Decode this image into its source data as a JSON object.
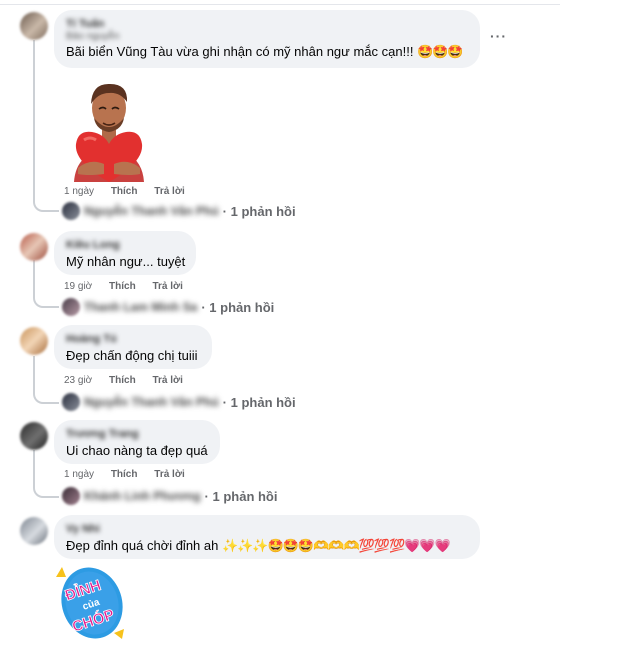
{
  "comments": [
    {
      "author": "Tí Tuấn",
      "author_sub": "Bảo nguyễn",
      "text": "Bãi biển Vũng Tàu vừa ghi nhận có mỹ nhân ngư mắc cạn!!!",
      "emojis": "🤩🤩🤩",
      "time": "1 ngày",
      "like": "Thích",
      "reply": "Trả lời",
      "reply_names": "Nguyễn Thanh Vân Phú",
      "reply_count": "· 1 phản hồi",
      "more": "···",
      "sticker": "3D man hugging heart"
    },
    {
      "author": "Kiều Long",
      "text": "Mỹ nhân ngư... tuyệt",
      "time": "19 giờ",
      "like": "Thích",
      "reply": "Trả lời",
      "reply_names": "Thanh Lam Minh Sa",
      "reply_count": "· 1 phản hồi"
    },
    {
      "author": "Hoàng Tú",
      "text": "Đẹp chấn động chị tuiii",
      "time": "23 giờ",
      "like": "Thích",
      "reply": "Trả lời",
      "reply_names": "Nguyễn Thanh Vân Phú",
      "reply_count": "· 1 phản hồi"
    },
    {
      "author": "Trương Trang",
      "text": "Ui chao nàng ta đẹp quá",
      "time": "1 ngày",
      "like": "Thích",
      "reply": "Trả lời",
      "reply_names": "Khánh Linh Phương",
      "reply_count": "· 1 phản hồi"
    },
    {
      "author": "Vy Nhi",
      "text": "Đẹp đỉnh quá chời đỉnh ah",
      "emojis": "✨✨✨🤩🤩🤩🫶🫶🫶💯💯💯💗💗💗",
      "sticker_text_1": "ĐỈNH",
      "sticker_text_2": "của",
      "sticker_text_3": "CHÓP"
    }
  ],
  "colors": {
    "bubble": "#f0f2f5",
    "meta": "#65676b",
    "sticker_blue": "#3aa0e8",
    "sticker_pink": "#e4168a"
  }
}
